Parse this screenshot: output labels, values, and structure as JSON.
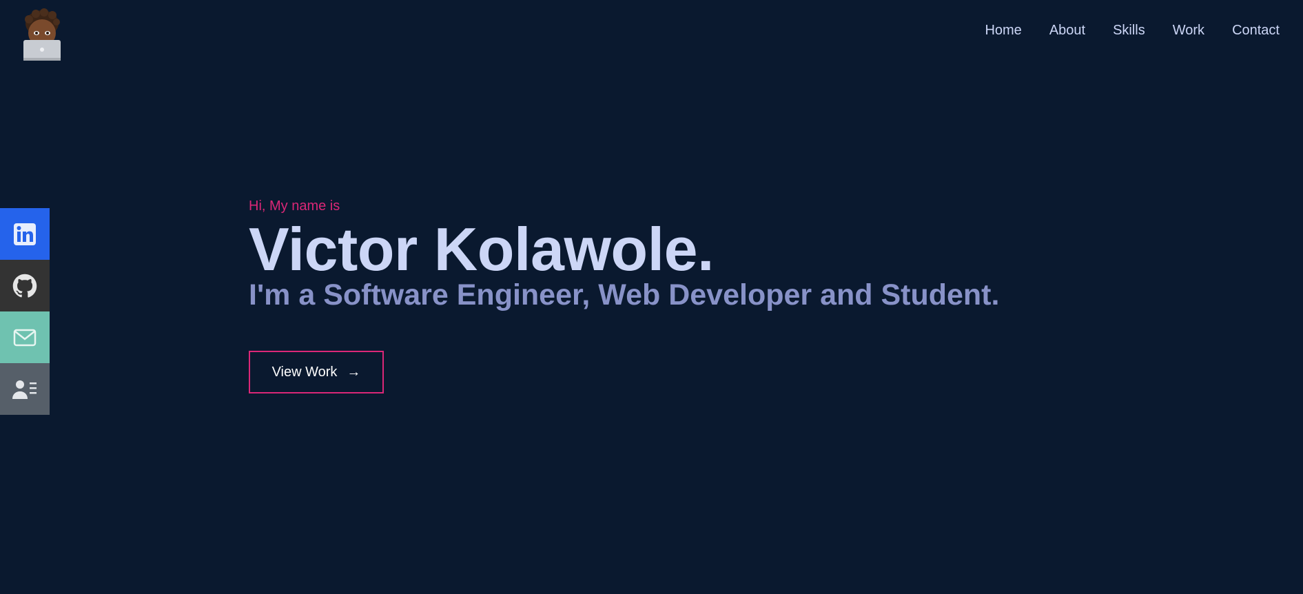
{
  "header": {
    "logo_icon": "memoji-avatar-with-laptop-icon"
  },
  "nav": {
    "items": [
      {
        "label": "Home"
      },
      {
        "label": "About"
      },
      {
        "label": "Skills"
      },
      {
        "label": "Work"
      },
      {
        "label": "Contact"
      }
    ]
  },
  "social": {
    "items": [
      {
        "icon": "linkedin-icon",
        "color": "#2563eb"
      },
      {
        "icon": "github-icon",
        "color": "#333333"
      },
      {
        "icon": "mail-icon",
        "color": "#6fc2b0"
      },
      {
        "icon": "resume-icon",
        "color": "#565f69"
      }
    ]
  },
  "hero": {
    "greeting": "Hi, My name is",
    "name": "Victor Kolawole.",
    "tagline": "I'm a Software Engineer, Web Developer and Student.",
    "cta_label": "View Work",
    "cta_arrow": "→"
  },
  "colors": {
    "background": "#0a192f",
    "accent": "#db2777",
    "heading": "#ccd6f6",
    "subheading": "#8892c8"
  }
}
